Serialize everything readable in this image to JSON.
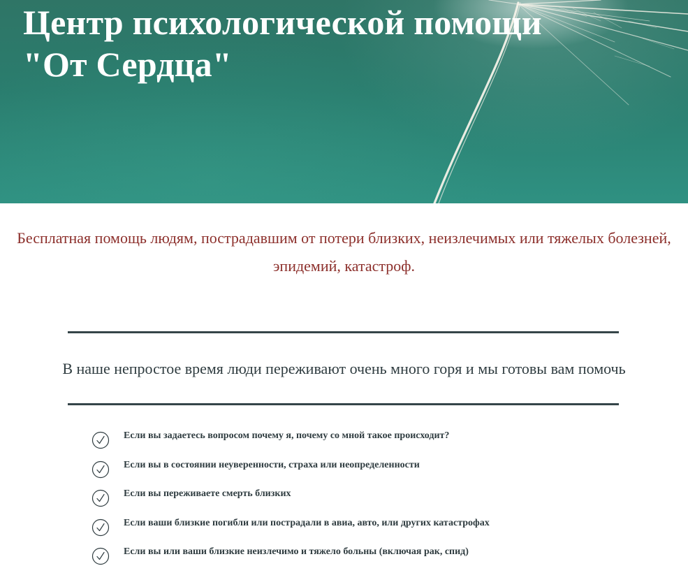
{
  "header": {
    "title_line1": "Центр психологической помощи",
    "title_line2": "\"От Сердца\"",
    "background_icon": "dandelion-seed-image",
    "background_color": "#2a7d6e"
  },
  "intro": {
    "subtitle": "Бесплатная помощь людям, пострадавшим от потери близких, неизлечимых или тяжелых болезней, эпидемий, катастроф.",
    "subtitle_color": "#8c2f2b"
  },
  "tagline": {
    "text": "В наше непростое время люди переживают очень много горя и мы готовы вам помочь",
    "color": "#2f3c40"
  },
  "checklist": {
    "icon": "check-circle-icon",
    "items": [
      {
        "label": "Если вы задаетесь вопросом почему я, почему со мной такое происходит?"
      },
      {
        "label": "Если вы в состоянии неуверенности, страха или неопределенности"
      },
      {
        "label": "Если вы переживаете смерть близких"
      },
      {
        "label": "Если ваши близкие погибли или пострадали в авиа, авто, или других катастрофах"
      },
      {
        "label": "Если вы или ваши близкие неизлечимо и тяжело больны (включая рак, спид)"
      }
    ]
  },
  "colors": {
    "divider": "#354549",
    "text": "#2f3c40"
  }
}
